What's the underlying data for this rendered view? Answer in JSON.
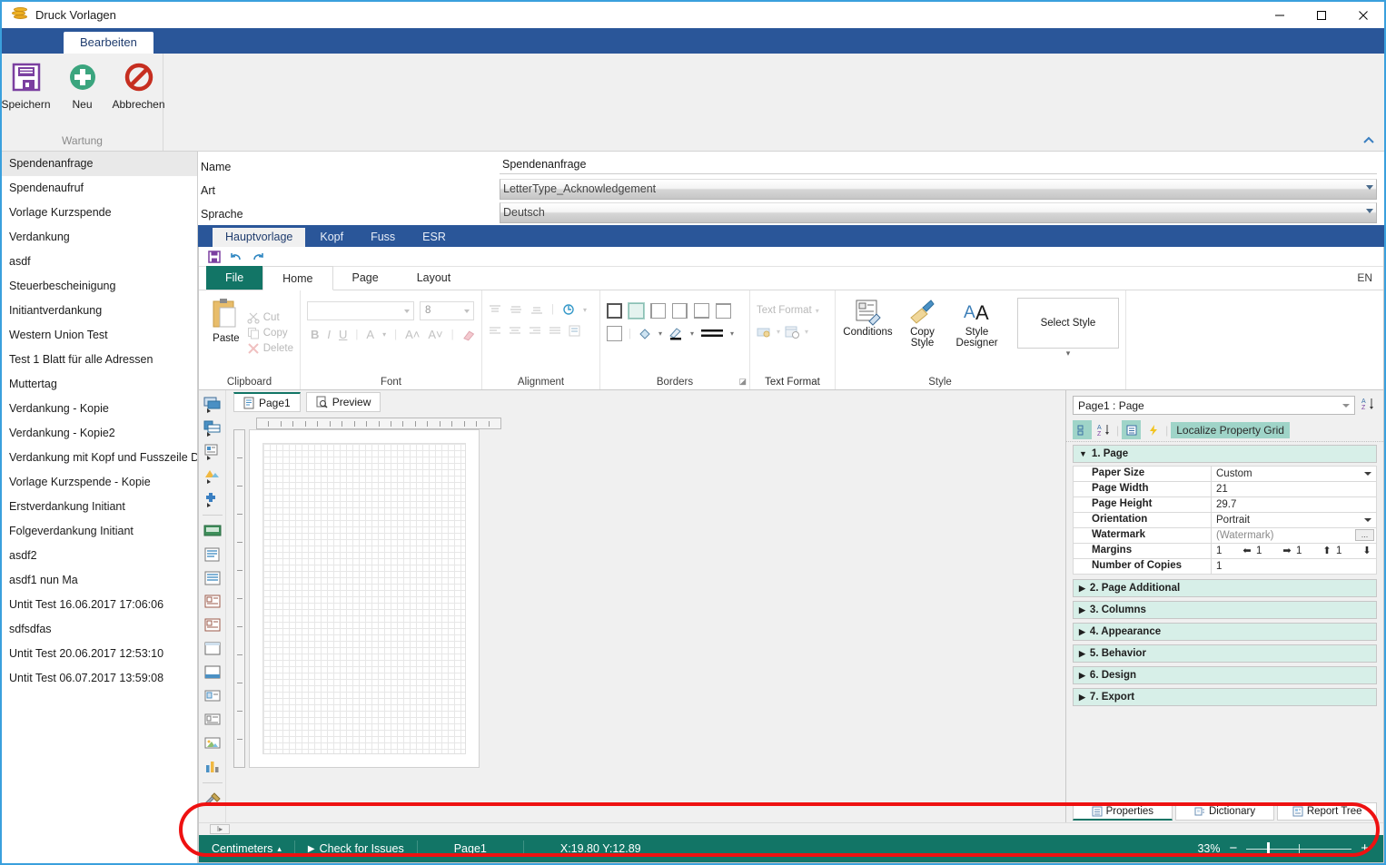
{
  "window": {
    "title": "Druck Vorlagen",
    "icon": "coins-icon",
    "minimize": "minimize-icon",
    "maximize": "maximize-icon",
    "close": "close-icon"
  },
  "outer_ribbon": {
    "tabs": [
      {
        "label": "Bearbeiten",
        "active": true
      }
    ],
    "group_label": "Wartung",
    "buttons": [
      {
        "label": "Speichern",
        "icon": "save-icon"
      },
      {
        "label": "Neu",
        "icon": "plus-circle-icon"
      },
      {
        "label": "Abbrechen",
        "icon": "cancel-icon"
      }
    ],
    "collapse_icon": "chevron-up-icon"
  },
  "template_list": {
    "items": [
      {
        "label": "Spendenanfrage",
        "selected": true
      },
      {
        "label": "Spendenaufruf",
        "selected": false
      },
      {
        "label": "Vorlage Kurzspende",
        "selected": false
      },
      {
        "label": "Verdankung",
        "selected": false
      },
      {
        "label": "asdf",
        "selected": false
      },
      {
        "label": "Steuerbescheinigung",
        "selected": false
      },
      {
        "label": "Initiantverdankung",
        "selected": false
      },
      {
        "label": "Western Union Test",
        "selected": false
      },
      {
        "label": "Test 1 Blatt für alle Adressen",
        "selected": false
      },
      {
        "label": "Muttertag",
        "selected": false
      },
      {
        "label": "Verdankung - Kopie",
        "selected": false
      },
      {
        "label": "Verdankung - Kopie2",
        "selected": false
      },
      {
        "label": "Verdankung mit Kopf und Fusszeile DE",
        "selected": false
      },
      {
        "label": "Vorlage Kurzspende - Kopie",
        "selected": false
      },
      {
        "label": "Erstverdankung Initiant",
        "selected": false
      },
      {
        "label": "Folgeverdankung Initiant",
        "selected": false
      },
      {
        "label": "asdf2",
        "selected": false
      },
      {
        "label": "asdf1 nun Ma",
        "selected": false
      },
      {
        "label": "Untit Test 16.06.2017 17:06:06",
        "selected": false
      },
      {
        "label": "sdfsdfas",
        "selected": false
      },
      {
        "label": "Untit Test 20.06.2017 12:53:10",
        "selected": false
      },
      {
        "label": "Untit Test 06.07.2017 13:59:08",
        "selected": false
      }
    ]
  },
  "form": {
    "fields": [
      {
        "label": "Name",
        "value": "Spendenanfrage",
        "type": "text"
      },
      {
        "label": "Art",
        "value": "LetterType_Acknowledgement",
        "type": "combo"
      },
      {
        "label": "Sprache",
        "value": "Deutsch",
        "type": "combo"
      }
    ]
  },
  "inner_tabs": [
    {
      "label": "Hauptvorlage",
      "active": true
    },
    {
      "label": "Kopf",
      "active": false
    },
    {
      "label": "Fuss",
      "active": false
    },
    {
      "label": "ESR",
      "active": false
    }
  ],
  "designer": {
    "quick_access": [
      {
        "icon": "save-icon"
      },
      {
        "icon": "undo-icon"
      },
      {
        "icon": "redo-icon"
      }
    ],
    "ribbon_tabs": [
      {
        "label": "File",
        "active": false,
        "style": "file"
      },
      {
        "label": "Home",
        "active": true,
        "style": "normal"
      },
      {
        "label": "Page",
        "active": false,
        "style": "normal"
      },
      {
        "label": "Layout",
        "active": false,
        "style": "normal"
      }
    ],
    "language": "EN",
    "groups": [
      {
        "name": "Clipboard",
        "label": "Clipboard",
        "paste": "Paste",
        "cut": "Cut",
        "copy": "Copy",
        "delete": "Delete"
      },
      {
        "name": "Font",
        "label": "Font",
        "font_family": "",
        "font_size": "8",
        "bold": "B",
        "italic": "I",
        "underline": "U"
      },
      {
        "name": "Alignment",
        "label": "Alignment"
      },
      {
        "name": "Borders",
        "label": "Borders"
      },
      {
        "name": "TextFormat",
        "label": "Text Format",
        "dropdown_label": "Text Format"
      },
      {
        "name": "Style",
        "label": "Style",
        "conditions": "Conditions",
        "copy_style": "Copy\nStyle",
        "copy_style_l1": "Copy",
        "copy_style_l2": "Style",
        "style_designer_l1": "Style",
        "style_designer_l2": "Designer",
        "select_style": "Select Style"
      }
    ],
    "page_tabs": [
      {
        "label": "Page1",
        "active": true,
        "icon": "page-icon"
      },
      {
        "label": "Preview",
        "active": false,
        "icon": "preview-icon"
      }
    ],
    "vertical_tools": [
      "select-band-icon",
      "table-band-icon",
      "data-band-icon",
      "image-band-icon",
      "plugin-band-icon",
      "footer-band-icon",
      "report-page-icon",
      "text-lines-icon",
      "text-box-icon",
      "rich-text-icon",
      "panel-icon",
      "sub-report-icon",
      "checkbox-field-icon",
      "text-field-icon",
      "image-field-icon",
      "chart-icon",
      "tools-icon"
    ]
  },
  "properties": {
    "object_selector": "Page1 : Page",
    "sort_az_icon": "sort-az-icon",
    "toolbar": {
      "categorized_icon": "categorized-icon",
      "alphabetical_icon": "alphabetical-icon",
      "properties_icon": "properties-icon",
      "events_icon": "events-icon",
      "localize_label": "Localize Property Grid"
    },
    "categories": [
      {
        "title": "1. Page",
        "expanded": true,
        "rows": [
          {
            "key": "Paper Size",
            "value": "Custom",
            "editor": "dropdown"
          },
          {
            "key": "Page Width",
            "value": "21",
            "editor": "text"
          },
          {
            "key": "Page Height",
            "value": "29.7",
            "editor": "text"
          },
          {
            "key": "Orientation",
            "value": "Portrait",
            "editor": "dropdown"
          },
          {
            "key": "Watermark",
            "value": "(Watermark)",
            "editor": "ellipsis"
          },
          {
            "key": "Margins",
            "value": "1 1 1 1",
            "editor": "margins",
            "margins": {
              "left": "1",
              "right": "1",
              "top": "1",
              "bottom": "1"
            }
          },
          {
            "key": "Number of Copies",
            "value": "1",
            "editor": "text"
          }
        ]
      },
      {
        "title": "2. Page  Additional",
        "expanded": false,
        "rows": []
      },
      {
        "title": "3. Columns",
        "expanded": false,
        "rows": []
      },
      {
        "title": "4. Appearance",
        "expanded": false,
        "rows": []
      },
      {
        "title": "5. Behavior",
        "expanded": false,
        "rows": []
      },
      {
        "title": "6. Design",
        "expanded": false,
        "rows": []
      },
      {
        "title": "7. Export",
        "expanded": false,
        "rows": []
      }
    ],
    "bottom_tabs": [
      {
        "label": "Properties",
        "active": true,
        "icon": "properties-tab-icon"
      },
      {
        "label": "Dictionary",
        "active": false,
        "icon": "dictionary-tab-icon"
      },
      {
        "label": "Report Tree",
        "active": false,
        "icon": "report-tree-icon"
      }
    ]
  },
  "statusbar": {
    "units": "Centimeters",
    "units_caret": "caret-up-icon",
    "check_for_issues": "Check for Issues",
    "page": "Page1",
    "coordinates": "X:19.80  Y:12.89",
    "zoom_level": "33%",
    "zoom_out": "−",
    "zoom_in": "+"
  },
  "colors": {
    "title_border": "#3aa0dd",
    "ribbon_blue": "#2a5699",
    "teal": "#127566",
    "prop_category": "#d7efe8",
    "annotation_red": "#ee1111"
  }
}
